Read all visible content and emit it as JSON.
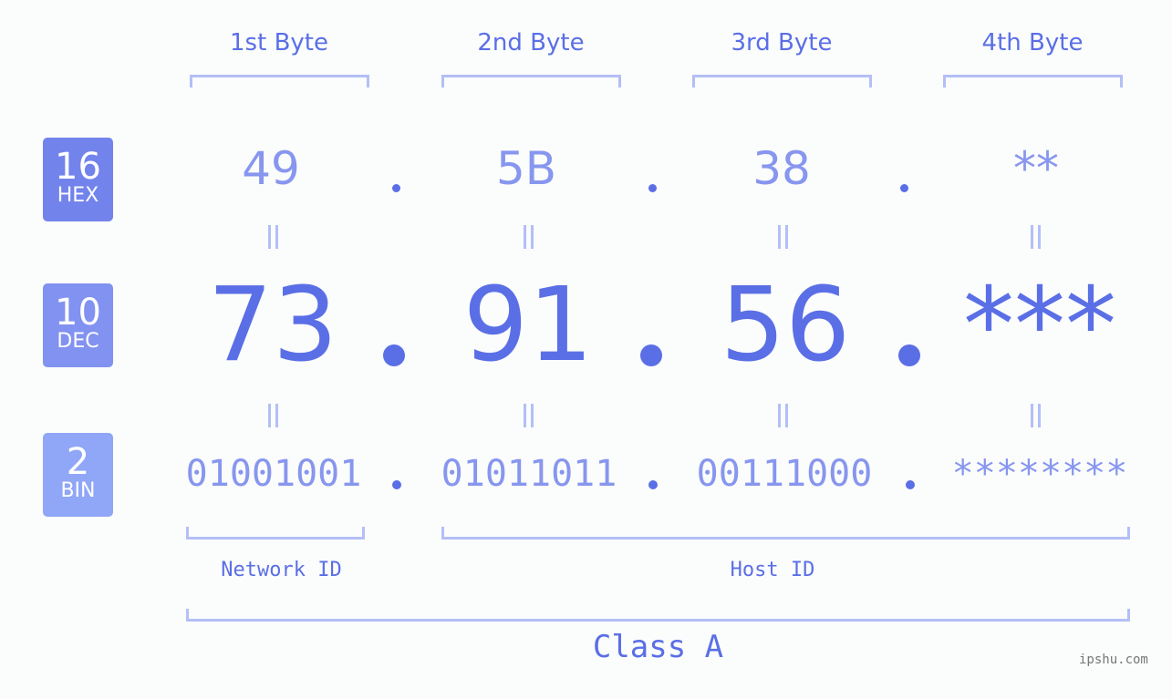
{
  "badges": [
    {
      "base": "16",
      "label": "HEX",
      "color": "#7383ec"
    },
    {
      "base": "10",
      "label": "DEC",
      "color": "#8292f0"
    },
    {
      "base": "2",
      "label": "BIN",
      "color": "#90a6f6"
    }
  ],
  "bytes": [
    {
      "header": "1st Byte",
      "hex": "49",
      "dec": "73",
      "bin": "01001001"
    },
    {
      "header": "2nd Byte",
      "hex": "5B",
      "dec": "91",
      "bin": "01011011"
    },
    {
      "header": "3rd Byte",
      "hex": "38",
      "dec": "56",
      "bin": "00111000"
    },
    {
      "header": "4th Byte",
      "hex": "**",
      "dec": "***",
      "bin": "********"
    }
  ],
  "segments": {
    "network": "Network ID",
    "host": "Host ID"
  },
  "class_label": "Class A",
  "watermark": "ipshu.com",
  "colors": {
    "accent": "#5a6fe6",
    "light": "#8796ee",
    "bracket": "#b3bff6"
  }
}
